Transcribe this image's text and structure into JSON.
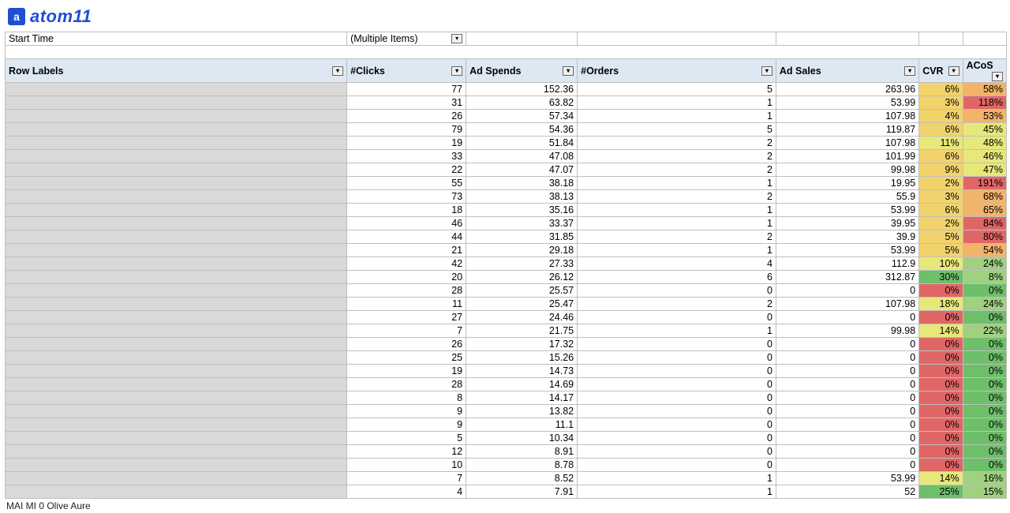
{
  "brand": {
    "logo_letter": "a",
    "name": "atom11"
  },
  "filter": {
    "key": "Start Time",
    "value": "(Multiple Items)",
    "filter_glyph": "▾"
  },
  "columns": {
    "row_labels": "Row Labels",
    "clicks": "#Clicks",
    "ad_spends": "Ad Spends",
    "orders": "#Orders",
    "ad_sales": "Ad Sales",
    "cvr": "CVR",
    "acos": "ACoS"
  },
  "truncated_footer": "MAI MI 0 Olive Aure",
  "heat": {
    "cvr_thresholds": [
      {
        "min": 20,
        "bg": "#6dbf6a"
      },
      {
        "min": 10,
        "bg": "#e8e87a"
      },
      {
        "min": 1,
        "bg": "#f2d36b"
      },
      {
        "min": 0,
        "bg": "#e06666"
      }
    ],
    "acos_thresholds": [
      {
        "max": 0,
        "bg": "#6dbf6a"
      },
      {
        "max": 25,
        "bg": "#a0d080"
      },
      {
        "max": 50,
        "bg": "#e8e87a"
      },
      {
        "max": 70,
        "bg": "#f2b36b"
      },
      {
        "max": 10000,
        "bg": "#e06666"
      }
    ]
  },
  "rows": [
    {
      "clicks": 77,
      "spends": "152.36",
      "orders": 5,
      "sales": "263.96",
      "cvr": "6%",
      "acos": "58%",
      "cvr_n": 6,
      "acos_n": 58
    },
    {
      "clicks": 31,
      "spends": "63.82",
      "orders": 1,
      "sales": "53.99",
      "cvr": "3%",
      "acos": "118%",
      "cvr_n": 3,
      "acos_n": 118
    },
    {
      "clicks": 26,
      "spends": "57.34",
      "orders": 1,
      "sales": "107.98",
      "cvr": "4%",
      "acos": "53%",
      "cvr_n": 4,
      "acos_n": 53
    },
    {
      "clicks": 79,
      "spends": "54.36",
      "orders": 5,
      "sales": "119.87",
      "cvr": "6%",
      "acos": "45%",
      "cvr_n": 6,
      "acos_n": 45
    },
    {
      "clicks": 19,
      "spends": "51.84",
      "orders": 2,
      "sales": "107.98",
      "cvr": "11%",
      "acos": "48%",
      "cvr_n": 11,
      "acos_n": 48
    },
    {
      "clicks": 33,
      "spends": "47.08",
      "orders": 2,
      "sales": "101.99",
      "cvr": "6%",
      "acos": "46%",
      "cvr_n": 6,
      "acos_n": 46
    },
    {
      "clicks": 22,
      "spends": "47.07",
      "orders": 2,
      "sales": "99.98",
      "cvr": "9%",
      "acos": "47%",
      "cvr_n": 9,
      "acos_n": 47
    },
    {
      "clicks": 55,
      "spends": "38.18",
      "orders": 1,
      "sales": "19.95",
      "cvr": "2%",
      "acos": "191%",
      "cvr_n": 2,
      "acos_n": 191
    },
    {
      "clicks": 73,
      "spends": "38.13",
      "orders": 2,
      "sales": "55.9",
      "cvr": "3%",
      "acos": "68%",
      "cvr_n": 3,
      "acos_n": 68
    },
    {
      "clicks": 18,
      "spends": "35.16",
      "orders": 1,
      "sales": "53.99",
      "cvr": "6%",
      "acos": "65%",
      "cvr_n": 6,
      "acos_n": 65
    },
    {
      "clicks": 46,
      "spends": "33.37",
      "orders": 1,
      "sales": "39.95",
      "cvr": "2%",
      "acos": "84%",
      "cvr_n": 2,
      "acos_n": 84
    },
    {
      "clicks": 44,
      "spends": "31.85",
      "orders": 2,
      "sales": "39.9",
      "cvr": "5%",
      "acos": "80%",
      "cvr_n": 5,
      "acos_n": 80
    },
    {
      "clicks": 21,
      "spends": "29.18",
      "orders": 1,
      "sales": "53.99",
      "cvr": "5%",
      "acos": "54%",
      "cvr_n": 5,
      "acos_n": 54
    },
    {
      "clicks": 42,
      "spends": "27.33",
      "orders": 4,
      "sales": "112.9",
      "cvr": "10%",
      "acos": "24%",
      "cvr_n": 10,
      "acos_n": 24
    },
    {
      "clicks": 20,
      "spends": "26.12",
      "orders": 6,
      "sales": "312.87",
      "cvr": "30%",
      "acos": "8%",
      "cvr_n": 30,
      "acos_n": 8
    },
    {
      "clicks": 28,
      "spends": "25.57",
      "orders": 0,
      "sales": "0",
      "cvr": "0%",
      "acos": "0%",
      "cvr_n": 0,
      "acos_n": 0
    },
    {
      "clicks": 11,
      "spends": "25.47",
      "orders": 2,
      "sales": "107.98",
      "cvr": "18%",
      "acos": "24%",
      "cvr_n": 18,
      "acos_n": 24
    },
    {
      "clicks": 27,
      "spends": "24.46",
      "orders": 0,
      "sales": "0",
      "cvr": "0%",
      "acos": "0%",
      "cvr_n": 0,
      "acos_n": 0
    },
    {
      "clicks": 7,
      "spends": "21.75",
      "orders": 1,
      "sales": "99.98",
      "cvr": "14%",
      "acos": "22%",
      "cvr_n": 14,
      "acos_n": 22
    },
    {
      "clicks": 26,
      "spends": "17.32",
      "orders": 0,
      "sales": "0",
      "cvr": "0%",
      "acos": "0%",
      "cvr_n": 0,
      "acos_n": 0
    },
    {
      "clicks": 25,
      "spends": "15.26",
      "orders": 0,
      "sales": "0",
      "cvr": "0%",
      "acos": "0%",
      "cvr_n": 0,
      "acos_n": 0
    },
    {
      "clicks": 19,
      "spends": "14.73",
      "orders": 0,
      "sales": "0",
      "cvr": "0%",
      "acos": "0%",
      "cvr_n": 0,
      "acos_n": 0
    },
    {
      "clicks": 28,
      "spends": "14.69",
      "orders": 0,
      "sales": "0",
      "cvr": "0%",
      "acos": "0%",
      "cvr_n": 0,
      "acos_n": 0
    },
    {
      "clicks": 8,
      "spends": "14.17",
      "orders": 0,
      "sales": "0",
      "cvr": "0%",
      "acos": "0%",
      "cvr_n": 0,
      "acos_n": 0
    },
    {
      "clicks": 9,
      "spends": "13.82",
      "orders": 0,
      "sales": "0",
      "cvr": "0%",
      "acos": "0%",
      "cvr_n": 0,
      "acos_n": 0
    },
    {
      "clicks": 9,
      "spends": "11.1",
      "orders": 0,
      "sales": "0",
      "cvr": "0%",
      "acos": "0%",
      "cvr_n": 0,
      "acos_n": 0
    },
    {
      "clicks": 5,
      "spends": "10.34",
      "orders": 0,
      "sales": "0",
      "cvr": "0%",
      "acos": "0%",
      "cvr_n": 0,
      "acos_n": 0
    },
    {
      "clicks": 12,
      "spends": "8.91",
      "orders": 0,
      "sales": "0",
      "cvr": "0%",
      "acos": "0%",
      "cvr_n": 0,
      "acos_n": 0
    },
    {
      "clicks": 10,
      "spends": "8.78",
      "orders": 0,
      "sales": "0",
      "cvr": "0%",
      "acos": "0%",
      "cvr_n": 0,
      "acos_n": 0
    },
    {
      "clicks": 7,
      "spends": "8.52",
      "orders": 1,
      "sales": "53.99",
      "cvr": "14%",
      "acos": "16%",
      "cvr_n": 14,
      "acos_n": 16
    },
    {
      "clicks": 4,
      "spends": "7.91",
      "orders": 1,
      "sales": "52",
      "cvr": "25%",
      "acos": "15%",
      "cvr_n": 25,
      "acos_n": 15
    }
  ]
}
